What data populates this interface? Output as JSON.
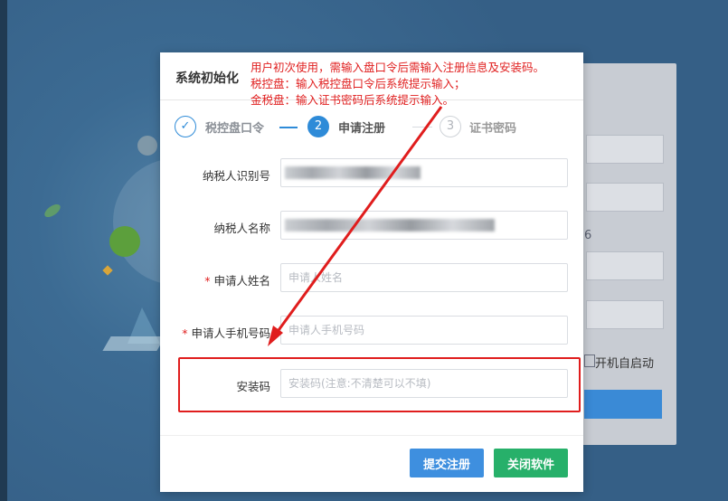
{
  "background": {
    "number_fragment": "6",
    "autostart_label": "开机自启动"
  },
  "dialog": {
    "title": "系统初始化",
    "note_lines": [
      "用户初次使用，需输入盘口令后需输入注册信息及安装码。",
      "税控盘：输入税控盘口令后系统提示输入；",
      "金税盘：输入证书密码后系统提示输入。"
    ],
    "steps": [
      {
        "number": "✓",
        "label": "税控盘口令"
      },
      {
        "number": "2",
        "label": "申请注册"
      },
      {
        "number": "3",
        "label": "证书密码"
      }
    ],
    "fields": {
      "taxpayer_id": {
        "label": "纳税人识别号",
        "value": ""
      },
      "taxpayer_name": {
        "label": "纳税人名称",
        "value": ""
      },
      "applicant_name": {
        "label": "申请人姓名",
        "placeholder": "申请人姓名",
        "required_mark": "*"
      },
      "applicant_phone": {
        "label": "申请人手机号码",
        "placeholder": "申请人手机号码",
        "required_mark": "*"
      },
      "install_code": {
        "label": "安装码",
        "placeholder": "安装码(注意:不清楚可以不填)"
      }
    },
    "buttons": {
      "submit": "提交注册",
      "close": "关闭软件"
    }
  },
  "colors": {
    "accent": "#2e8bd8",
    "annotation_red": "#e01d1d",
    "close_green": "#27b06a"
  }
}
